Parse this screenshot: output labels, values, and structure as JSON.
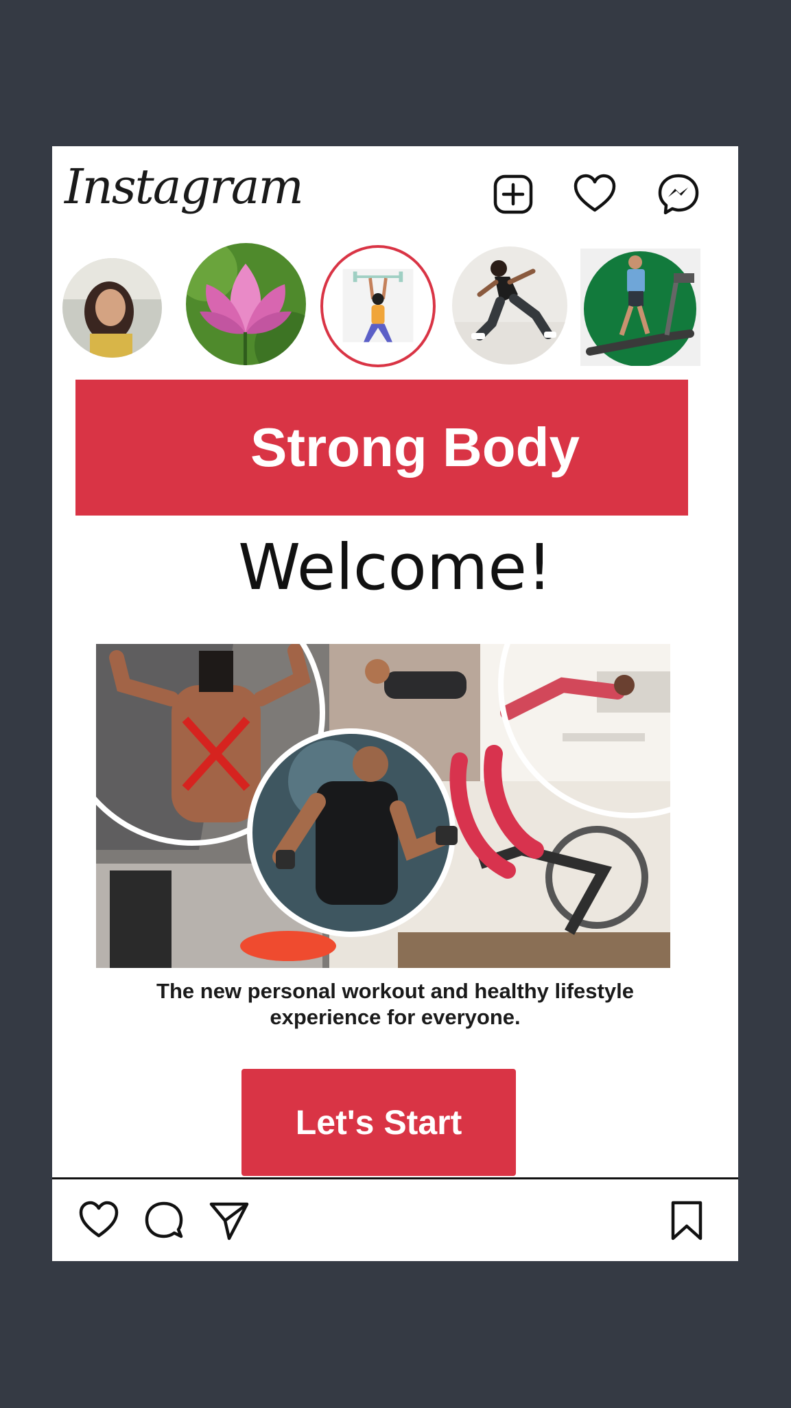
{
  "app": {
    "logo_text": "Instagram"
  },
  "header": {
    "icons": [
      "new-post-icon",
      "heart-icon",
      "messenger-icon"
    ]
  },
  "stories": [
    {
      "name": "your-story",
      "has_add_badge": true
    },
    {
      "name": "lotus-story"
    },
    {
      "name": "weightlifter-story",
      "active_ring": true
    },
    {
      "name": "runner-story"
    },
    {
      "name": "treadmill-story"
    }
  ],
  "post": {
    "banner_title": "Strong Body",
    "welcome": "Welcome!",
    "subtitle_line1": "The new personal workout and healthy lifestyle",
    "subtitle_line2": "experience for everyone.",
    "cta_label": "Let's Start"
  },
  "actions": {
    "icons": [
      "like-icon",
      "comment-icon",
      "share-icon",
      "bookmark-icon"
    ]
  },
  "colors": {
    "background": "#353a44",
    "accent": "#d93445",
    "badge": "#1e88e5"
  }
}
